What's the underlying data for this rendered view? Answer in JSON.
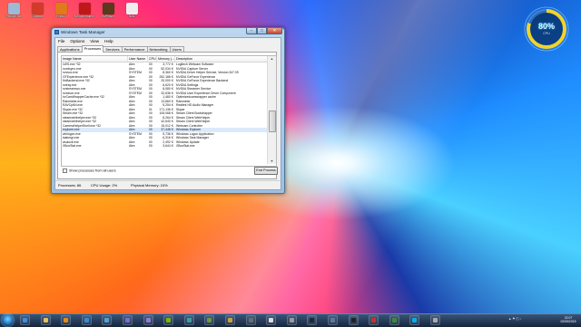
{
  "desktop_icons": [
    {
      "label": "Recycle Bin",
      "color": "#9db9d6"
    },
    {
      "label": "CCleaner",
      "color": "#d23a2a"
    },
    {
      "label": "Firefox",
      "color": "#e07a1a"
    },
    {
      "label": "MSI Afterburner",
      "color": "#c01818"
    },
    {
      "label": "KMPlayer",
      "color": "#5a3a1a"
    },
    {
      "label": "New",
      "color": "#eeeeee"
    }
  ],
  "gadget": {
    "percent": "80%",
    "sub": "CPU",
    "value": 0.8
  },
  "window": {
    "title": "Windows Task Manager",
    "menu": [
      "File",
      "Options",
      "View",
      "Help"
    ],
    "tabs": [
      "Applications",
      "Processes",
      "Services",
      "Performance",
      "Networking",
      "Users"
    ],
    "active_tab": "Processes",
    "columns": [
      "Image Name",
      "User Name",
      "CPU",
      "Memory (...",
      "Description"
    ],
    "rows": [
      [
        "LWS.exe *32",
        "Alex",
        "00",
        "3,772 K",
        "Logitech Webcam Software"
      ],
      [
        "nvxdsync.exe",
        "Alex",
        "00",
        "52,034 K",
        "NVIDIA Capture Server"
      ],
      [
        "nvvsvc.exe",
        "SYSTEM",
        "00",
        "8,360 K",
        "NVIDIA Driver Helper Service, Version 347.09"
      ],
      [
        "GFExperience.exe *32",
        "Alex",
        "00",
        "252,188 K",
        "NVIDIA GeForce Experience"
      ],
      [
        "NvBackend.exe *32",
        "Alex",
        "00",
        "20,000 K",
        "NVIDIA GeForce Experience Backend"
      ],
      [
        "nvtray.exe",
        "Alex",
        "00",
        "6,620 K",
        "NVIDIA Settings"
      ],
      [
        "nvstreamsvc.exe",
        "SYSTEM",
        "00",
        "8,080 K",
        "NVIDIA Streamer Service"
      ],
      [
        "nvxdsvc.exe",
        "SYSTEM",
        "00",
        "32,636 K",
        "NVIDIA User Experience Driver Component"
      ],
      [
        "hvCamWrapperCache.exe *32",
        "Alex",
        "00",
        "1,460 K",
        "Optimizedcamwrapper cache"
      ],
      [
        "Rainmeter.exe",
        "Alex",
        "00",
        "13,860 K",
        "Rainmeter"
      ],
      [
        "RAVCpl64.exe",
        "Alex",
        "00",
        "5,254 K",
        "Realtek HD Audio Manager"
      ],
      [
        "Skype.exe *32",
        "Alex",
        "01",
        "171,136 K",
        "Skype"
      ],
      [
        "Steam.exe *32",
        "Alex",
        "00",
        "105,068 K",
        "Steam Client Bootstrapper"
      ],
      [
        "steamwebhelper.exe *32",
        "Alex",
        "00",
        "8,264 K",
        "Steam Client WebHelper"
      ],
      [
        "steamwebhelper.exe *32",
        "Alex",
        "00",
        "42,640 K",
        "Steam Client WebHelper"
      ],
      [
        "CameraHelperShell.exe *32",
        "Alex",
        "00",
        "15,012 K",
        "Webcam Controller"
      ],
      [
        "explorer.exe",
        "Alex",
        "00",
        "37,448 K",
        "Windows Explorer"
      ],
      [
        "winlogon.exe",
        "SYSTEM",
        "00",
        "5,736 K",
        "Windows Logon Application"
      ],
      [
        "taskmgr.exe",
        "Alex",
        "00",
        "6,316 K",
        "Windows Task Manager"
      ],
      [
        "wuauclt.exe",
        "Alex",
        "00",
        "2,492 K",
        "Windows Update"
      ],
      [
        "XBoxStat.exe",
        "Alex",
        "00",
        "3,644 K",
        "XBoxStat.exe"
      ]
    ],
    "selected_row": 16,
    "show_all_label": "Show processes from all users",
    "end_process_label": "End Process",
    "status": {
      "processes": "Processes: 86",
      "cpu": "CPU Usage: 2%",
      "memory": "Physical Memory: 24%"
    }
  },
  "taskbar": {
    "items": [
      {
        "name": "ie-icon",
        "color": "#3a8fe0"
      },
      {
        "name": "explorer-folder-icon",
        "color": "#e8c05a"
      },
      {
        "name": "media-player-icon",
        "color": "#e58a1a"
      },
      {
        "name": "photoshop-icon",
        "color": "#2e8fd8"
      },
      {
        "name": "lightroom-icon",
        "color": "#4aa3d8"
      },
      {
        "name": "premiere-icon",
        "color": "#7a6ad8"
      },
      {
        "name": "aftereffects-icon",
        "color": "#8f7ad8"
      },
      {
        "name": "nvidia-icon",
        "color": "#76b900"
      },
      {
        "name": "speccy-icon",
        "color": "#3aa0a0"
      },
      {
        "name": "minecraft-icon",
        "color": "#6a9a3a"
      },
      {
        "name": "folder-icon",
        "color": "#caa040"
      },
      {
        "name": "game-icon",
        "color": "#607070"
      },
      {
        "name": "unity-icon",
        "color": "#dddddd"
      },
      {
        "name": "app-icon",
        "color": "#9a9a9a"
      },
      {
        "name": "steam-icon",
        "color": "#1b2838"
      },
      {
        "name": "app2-icon",
        "color": "#5a7a9a"
      },
      {
        "name": "cmd-icon",
        "color": "#222222"
      },
      {
        "name": "filezilla-icon",
        "color": "#c8302a"
      },
      {
        "name": "taskmgr-icon",
        "color": "#3a8a3a"
      },
      {
        "name": "skype-icon",
        "color": "#00aff0"
      },
      {
        "name": "app3-icon",
        "color": "#aaaaaa"
      }
    ],
    "clock_time": "22:07",
    "clock_date": "02/05/2015"
  }
}
